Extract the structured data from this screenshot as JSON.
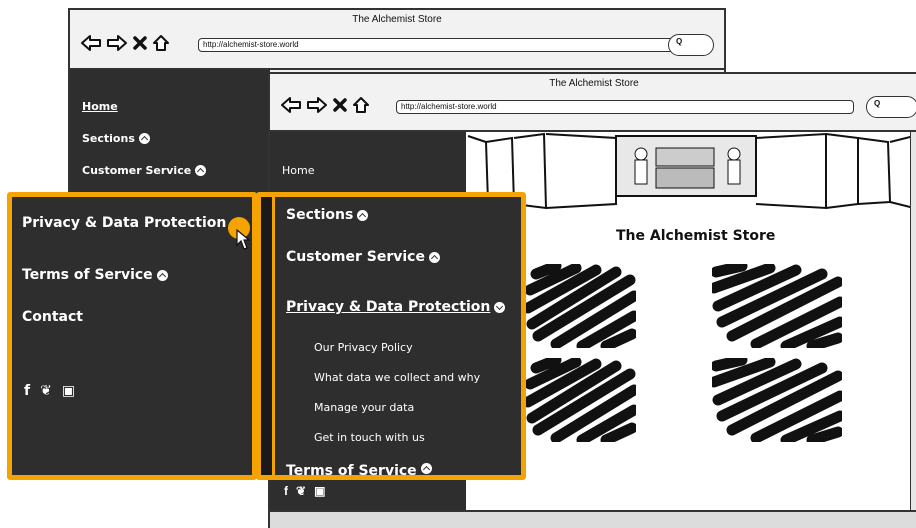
{
  "back_window": {
    "title": "The Alchemist Store",
    "url": "http://alchemist-store.world",
    "nav": [
      "Home",
      "Sections",
      "Customer Service"
    ]
  },
  "front_window": {
    "title": "The Alchemist Store",
    "url": "http://alchemist-store.world",
    "nav_home": "Home",
    "store_title": "The Alchemist Store"
  },
  "left_menu": {
    "items": [
      "Privacy & Data Protection",
      "Terms of Service",
      "Contact"
    ]
  },
  "right_menu": {
    "sections": "Sections",
    "customer_service": "Customer Service",
    "privacy": "Privacy & Data Protection",
    "subitems": [
      "Our Privacy Policy",
      "What data we collect and why",
      "Manage your data",
      "Get in touch with us"
    ],
    "terms_partial": "Terms of Service"
  },
  "social": {
    "icons": [
      "facebook-icon",
      "twitter-icon",
      "instagram-icon"
    ],
    "glyphs": [
      "f",
      "❦",
      "▣"
    ]
  },
  "colors": {
    "sidebar_bg": "#2e2e2e",
    "highlight": "#f5a300",
    "window_bg": "#f2f2f2"
  }
}
